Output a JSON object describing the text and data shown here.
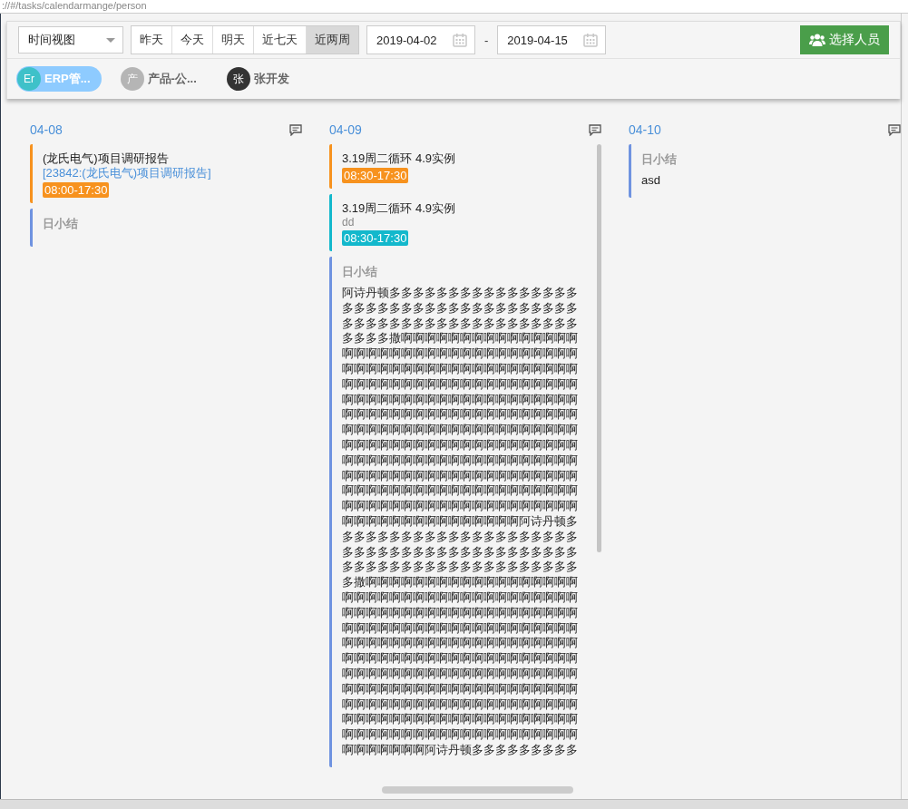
{
  "address_bar": "://#/tasks/calendarmange/person",
  "view_select": {
    "value": "时间视图"
  },
  "range_buttons": [
    {
      "label": "昨天",
      "selected": false
    },
    {
      "label": "今天",
      "selected": false
    },
    {
      "label": "明天",
      "selected": false
    },
    {
      "label": "近七天",
      "selected": false
    },
    {
      "label": "近两周",
      "selected": true
    }
  ],
  "date_from": "2019-04-02",
  "date_separator": "-",
  "date_to": "2019-04-15",
  "select_people_button": "选择人员",
  "people": [
    {
      "avatar": "Er",
      "name": "ERP管...",
      "selected": true,
      "color": "#3fc1c9"
    },
    {
      "avatar": "产",
      "name": "产品-公...",
      "selected": false,
      "color": "#b5b5b5"
    },
    {
      "avatar": "张",
      "name": "张开发",
      "selected": false,
      "color": "#333333"
    }
  ],
  "days": [
    {
      "date": "04-08",
      "entries": [
        {
          "kind": "task",
          "title": "(龙氏电气)项目调研报告",
          "link": "[23842:(龙氏电气)项目调研报告]",
          "time": "08:00-17:30",
          "color": "#f7921e"
        },
        {
          "kind": "summary",
          "title": "日小结"
        }
      ]
    },
    {
      "date": "04-09",
      "entries": [
        {
          "kind": "task",
          "title": "3.19周二循环 4.9实例",
          "time": "08:30-17:30",
          "color": "#f7921e"
        },
        {
          "kind": "task",
          "title": "3.19周二循环 4.9实例",
          "note": "dd",
          "time": "08:30-17:30",
          "color": "#13b8cc"
        },
        {
          "kind": "summary",
          "title": "日小结",
          "body": "阿诗丹顿多多多多多多多多多多多多多多多多多多多多多多多多多多多多多多多多多多多多多多多多多多多多多多多多多多多多多多多多多多多多撒啊啊啊啊啊啊啊啊啊啊啊啊啊啊啊啊啊啊啊啊啊啊啊啊啊啊啊啊啊啊啊啊啊啊啊啊啊啊啊啊啊啊啊啊啊啊啊啊啊啊啊啊啊啊啊啊啊啊啊啊啊啊啊啊啊啊啊啊啊啊啊啊啊啊啊啊啊啊啊啊啊啊啊啊啊啊啊啊啊啊啊啊啊啊啊啊啊啊啊啊啊啊啊啊啊啊啊啊啊啊啊啊啊啊啊啊啊啊啊啊啊啊啊啊啊啊啊啊啊啊啊啊啊啊啊啊啊啊啊啊啊啊啊啊啊啊啊啊啊啊啊啊啊啊啊啊啊啊啊啊啊啊啊啊啊啊啊啊啊啊啊啊啊啊啊啊啊啊啊啊啊啊啊啊啊啊啊啊啊啊啊啊啊啊啊啊啊啊啊啊啊啊啊啊啊啊啊啊啊啊啊啊啊啊啊啊啊啊啊啊啊啊啊啊啊啊啊啊啊啊啊啊啊啊啊啊啊啊啊啊啊啊啊啊啊啊啊啊啊啊阿诗丹顿多多多多多多多多多多多多多多多多多多多多多多多多多多多多多多多多多多多多多多多多多多多多多多多多多多多多多多多多多多多多多多撒啊啊啊啊啊啊啊啊啊啊啊啊啊啊啊啊啊啊啊啊啊啊啊啊啊啊啊啊啊啊啊啊啊啊啊啊啊啊啊啊啊啊啊啊啊啊啊啊啊啊啊啊啊啊啊啊啊啊啊啊啊啊啊啊啊啊啊啊啊啊啊啊啊啊啊啊啊啊啊啊啊啊啊啊啊啊啊啊啊啊啊啊啊啊啊啊啊啊啊啊啊啊啊啊啊啊啊啊啊啊啊啊啊啊啊啊啊啊啊啊啊啊啊啊啊啊啊啊啊啊啊啊啊啊啊啊啊啊啊啊啊啊啊啊啊啊啊啊啊啊啊啊啊啊啊啊啊啊啊啊啊啊啊啊啊啊啊啊啊啊啊啊啊啊啊啊啊啊啊啊啊啊啊啊啊啊啊啊啊啊啊啊啊啊啊啊啊啊啊啊啊啊啊啊啊啊啊啊啊啊啊啊啊啊啊啊啊啊啊啊啊啊啊啊啊阿诗丹顿多多多多多多多多多"
        }
      ]
    },
    {
      "date": "04-10",
      "entries": [
        {
          "kind": "summary",
          "title": "日小结",
          "body": "asd"
        }
      ]
    }
  ]
}
